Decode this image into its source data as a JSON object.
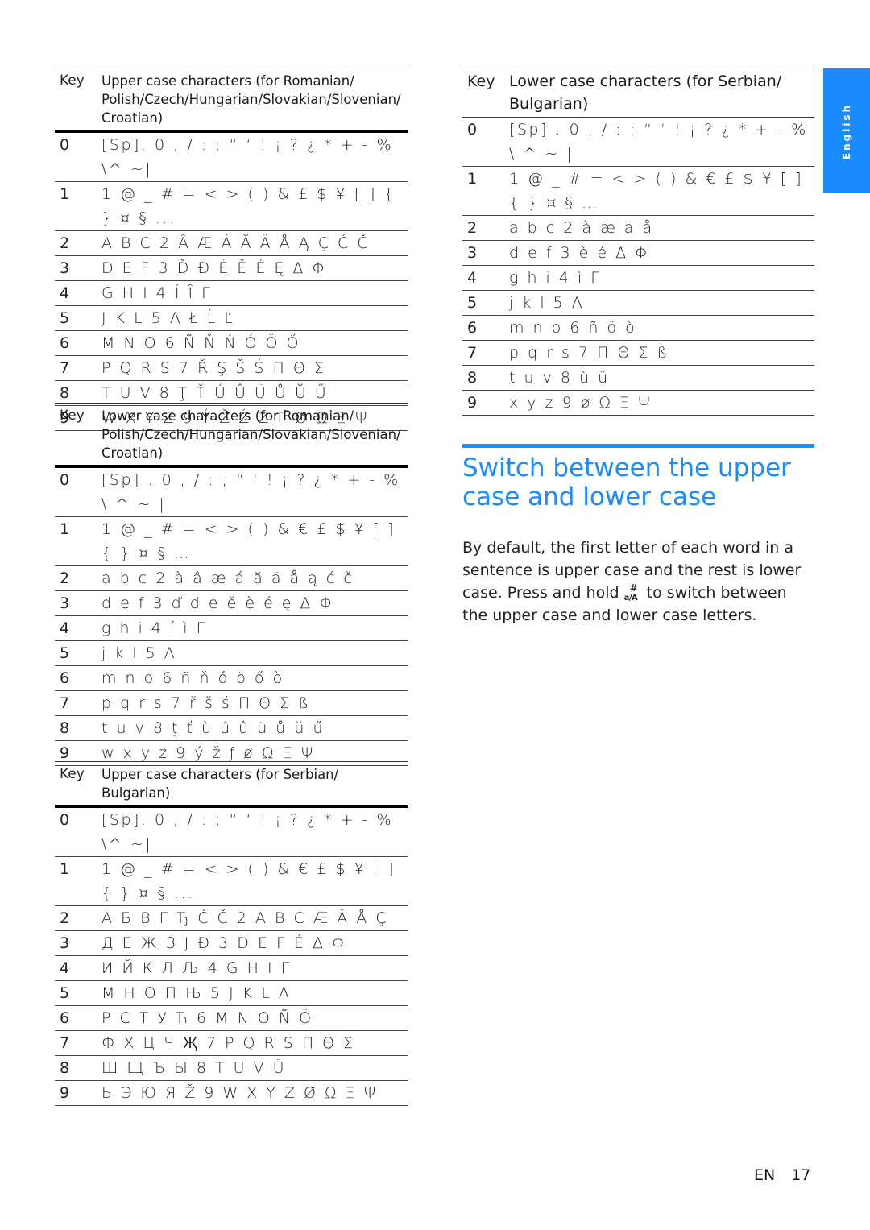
{
  "side_tab": {
    "label": "English",
    "color": "#1a8cff"
  },
  "tables": {
    "ro_upper": {
      "key_header": "Key",
      "title": "Upper case characters (for Romanian/ Polish/Czech/Hungarian/Slovakian/Slovenian/ Croatian)",
      "rows": [
        {
          "key": "0",
          "chars": "[Sp]. 0 , / : ; “ ‘ ! ¡ ? ¿ * + - % \\^ ~|"
        },
        {
          "key": "1",
          "chars": "1 @ _ # = < > ( ) & £ $ ¥ [ ] { } ¤ § ..."
        },
        {
          "key": "2",
          "chars": "A B C 2 Â Æ Á Ă Ä Å Ą Ç Ć Č"
        },
        {
          "key": "3",
          "chars": "D E F 3 Ď Đ Ė Ě É Ę Δ Φ"
        },
        {
          "key": "4",
          "chars": "G H I 4 Í Î Γ"
        },
        {
          "key": "5",
          "chars": "J K L 5 Λ Ł Ĺ Ľ"
        },
        {
          "key": "6",
          "chars": "M N O 6 Ñ Ň Ń Ó Ö Ő"
        },
        {
          "key": "7",
          "chars": "P Q R S 7 Ř Ş Š Ś Π Θ Σ"
        },
        {
          "key": "8",
          "chars": "T U V 8 Ţ Ť Ú Û Ü Ů Ŭ Ű"
        },
        {
          "key": "9",
          "chars": "W X Y Z 9 Ý Ž Ź Ż Ґ Ø Ω Ξ Ψ"
        }
      ]
    },
    "ro_lower": {
      "key_header": "Key",
      "title": "Lower case characters (for Romanian/ Polish/Czech/Hungarian/Slovakian/Slovenian/ Croatian)",
      "rows": [
        {
          "key": "0",
          "chars": "[Sp] . 0 , / : ; “ ‘ ! ¡ ? ¿ * + - % \\ ^ ~ |"
        },
        {
          "key": "1",
          "chars": "1 @ _ # = < > ( ) & € £ $ ¥ [ ] { } ¤ § …"
        },
        {
          "key": "2",
          "chars": "a b c 2 à â æ á ă ä å ą ć č"
        },
        {
          "key": "3",
          "chars": "d e f 3 ď đ ė ě è é ę Δ Φ"
        },
        {
          "key": "4",
          "chars": "g h i 4 í ì Γ"
        },
        {
          "key": "5",
          "chars": "j k l 5 Λ"
        },
        {
          "key": "6",
          "chars": "m n o 6 ñ ň ó ö ő ò"
        },
        {
          "key": "7",
          "chars": "p q r s 7 ř š ś Π Θ Σ ß"
        },
        {
          "key": "8",
          "chars": "t u v 8 ţ ť ù ú û ü ů ŭ ű"
        },
        {
          "key": "9",
          "chars": "w x y z 9 ý ž ƒ ø Ω Ξ Ψ"
        }
      ]
    },
    "sr_upper": {
      "key_header": "Key",
      "title": "Upper case characters (for Serbian/ Bulgarian)",
      "rows": [
        {
          "key": "0",
          "chars": "[Sp]. 0 , / : ; “ ‘ ! ¡ ? ¿ * + - % \\^ ~|"
        },
        {
          "key": "1",
          "chars": "1 @ _ # = < > ( ) & € £ $ ¥ [ ] { } ¤ § ..."
        },
        {
          "key": "2",
          "chars": "А Б В Г Ђ Ć Č 2 A B C Æ Ä Å Ç"
        },
        {
          "key": "3",
          "chars": "Д Е Ж З Ј Ð 3 D E F É Δ Φ"
        },
        {
          "key": "4",
          "chars": "И Й К Л Љ 4 G H I Γ"
        },
        {
          "key": "5",
          "chars": "М Н О П Њ 5 J K L Λ"
        },
        {
          "key": "6",
          "chars": "Р С Т У Ћ 6 M N O Ñ Ö"
        },
        {
          "key": "7",
          "chars": "Ф Х Ц Ч Җ 7 P Q R S Π Θ Σ"
        },
        {
          "key": "8",
          "chars": "Ш Щ Ъ Ы 8 T U V Ü"
        },
        {
          "key": "9",
          "chars": "Ь Э Ю Я Ž 9 W X Y Z Ø Ω Ξ Ψ"
        }
      ]
    },
    "sr_lower": {
      "key_header": "Key",
      "title": "Lower case characters (for Serbian/ Bulgarian)",
      "rows": [
        {
          "key": "0",
          "chars": "[Sp] . 0 , / : ; “ ‘ ! ¡ ? ¿ * + - % \\ ^ ~ |"
        },
        {
          "key": "1",
          "chars": "1 @ _ # = < > ( ) & € £ $ ¥ [ ] { } ¤ § …"
        },
        {
          "key": "2",
          "chars": "a b c 2 à æ ä å"
        },
        {
          "key": "3",
          "chars": "d e f 3 è é Δ Φ"
        },
        {
          "key": "4",
          "chars": "g h i 4 ì Γ"
        },
        {
          "key": "5",
          "chars": "j k l 5 Λ"
        },
        {
          "key": "6",
          "chars": "m n o 6 ñ ö ò"
        },
        {
          "key": "7",
          "chars": "p q r s 7 Π Θ Σ ß"
        },
        {
          "key": "8",
          "chars": "t u v 8 ù ü"
        },
        {
          "key": "9",
          "chars": "x y z 9 ø Ω Ξ Ψ"
        }
      ]
    }
  },
  "section": {
    "title": "Switch between the upper case and lower case",
    "body_before": "By default, the first letter of each word in a sentence is upper case and the rest is lower case. Press and hold ",
    "key_icon": {
      "name": "hash-case-key-icon",
      "top": "#",
      "bottom": "a/A"
    },
    "body_after": " to switch between the upper case and lower case letters."
  },
  "footer": {
    "lang": "EN",
    "page": "17"
  }
}
